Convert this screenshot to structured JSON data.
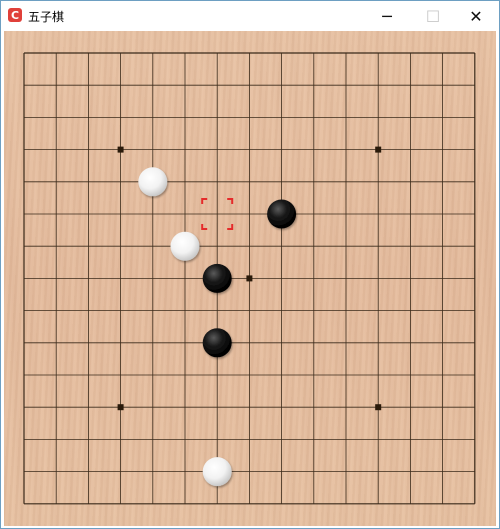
{
  "window": {
    "title": "五子棋",
    "icon": "C"
  },
  "controls": {
    "minimize": "─",
    "maximize": "☐",
    "close": "✕"
  },
  "board": {
    "size": 15,
    "star_points": [
      [
        3,
        3
      ],
      [
        11,
        3
      ],
      [
        7,
        7
      ],
      [
        3,
        11
      ],
      [
        11,
        11
      ]
    ],
    "stones": [
      {
        "col": 4,
        "row": 4,
        "color": "white"
      },
      {
        "col": 8,
        "row": 5,
        "color": "black"
      },
      {
        "col": 5,
        "row": 6,
        "color": "white"
      },
      {
        "col": 6,
        "row": 7,
        "color": "black"
      },
      {
        "col": 6,
        "row": 9,
        "color": "black"
      },
      {
        "col": 6,
        "row": 13,
        "color": "white"
      }
    ],
    "cursor": {
      "col": 6,
      "row": 5
    },
    "colors": {
      "line": "#3a2a1a",
      "cursor": "#e52b2b"
    }
  }
}
